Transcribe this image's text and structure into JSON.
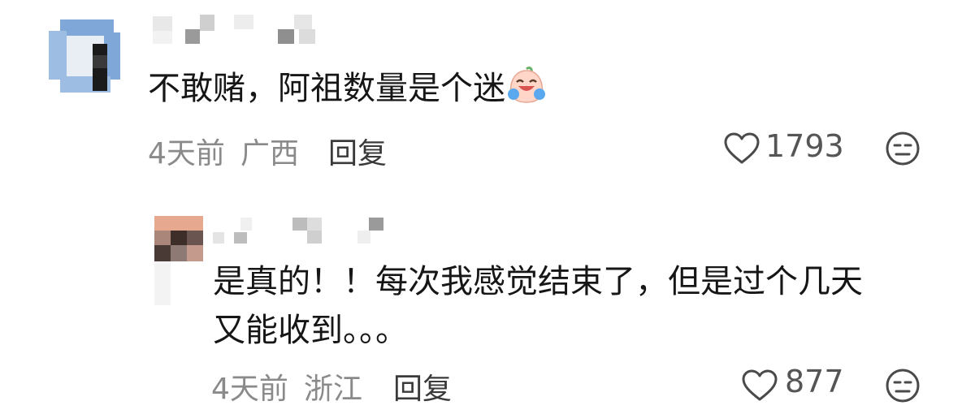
{
  "comments": [
    {
      "text": "不敢赌，阿祖数量是个迷",
      "emoji": "crying-laughing-sticker",
      "time": "4天前",
      "location": "广西",
      "reply_label": "回复",
      "likes": "1793"
    }
  ],
  "replies": [
    {
      "text_line1": "是真的！！每次我感觉结束了，但是过个几天",
      "text_line2": "又能收到。。。",
      "time": "4天前",
      "location": "浙江",
      "reply_label": "回复",
      "likes": "877"
    }
  ],
  "icons": {
    "like": "heart-outline-icon",
    "dislike": "meh-face-icon"
  },
  "colors": {
    "text": "#161616",
    "meta": "#8a8a8a",
    "icon": "#4a4a4a"
  }
}
